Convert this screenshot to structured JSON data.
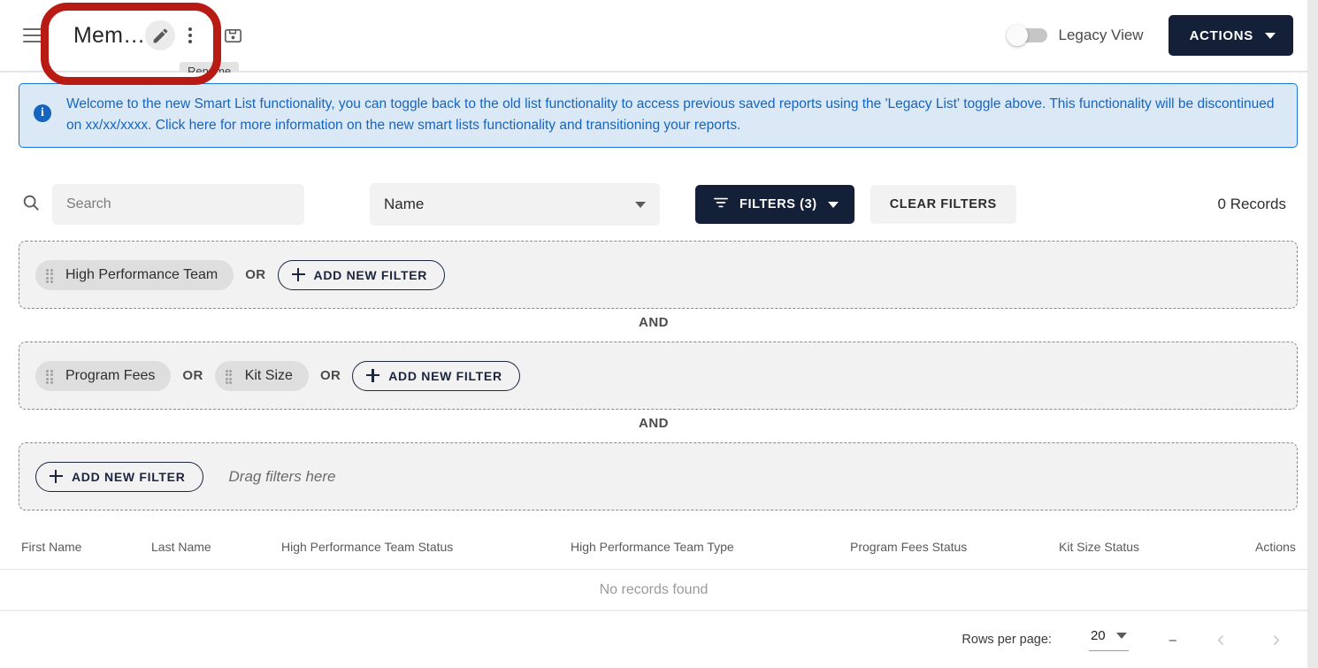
{
  "header": {
    "menu_icon": "hamburger-menu-icon",
    "title": "Mem…",
    "edit_icon": "pencil-icon",
    "more_icon": "kebab-more-icon",
    "save_icon": "save-disk-icon",
    "tooltip": "Rename",
    "toggle_label": "Legacy View",
    "toggle_state": "off",
    "actions_label": "ACTIONS"
  },
  "banner": {
    "icon": "info-icon",
    "text": "Welcome to the new Smart List functionality, you can toggle back to the old list functionality to access previous saved reports using the 'Legacy List' toggle above. This functionality will be discontinued on xx/xx/xxxx. Click here for more information on the new smart lists functionality and transitioning your reports."
  },
  "toolbar": {
    "search_icon": "search-icon",
    "search_placeholder": "Search",
    "search_value": "",
    "field_select_value": "Name",
    "filters_label": "FILTERS (3)",
    "filters_icon": "filter-icon",
    "clear_filters_label": "CLEAR FILTERS",
    "records_count": "0 Records"
  },
  "filter_builder": {
    "add_filter_label": "ADD NEW FILTER",
    "or_label": "OR",
    "and_label": "AND",
    "drag_hint": "Drag filters here",
    "groups": [
      {
        "chips": [
          "High Performance Team"
        ]
      },
      {
        "chips": [
          "Program Fees",
          "Kit Size"
        ]
      },
      {
        "chips": []
      }
    ]
  },
  "table": {
    "columns": [
      "First Name",
      "Last Name",
      "High Performance Team Status",
      "High Performance Team Type",
      "Program Fees Status",
      "Kit Size Status",
      "Actions"
    ],
    "rows": [],
    "empty_message": "No records found"
  },
  "pagination": {
    "rows_per_page_label": "Rows per page:",
    "rows_per_page_value": "20",
    "range_text": "–",
    "prev_icon": "chevron-left-icon",
    "next_icon": "chevron-right-icon"
  },
  "annotation": {
    "shape": "rounded-rect-highlight",
    "color": "#b81b13"
  }
}
